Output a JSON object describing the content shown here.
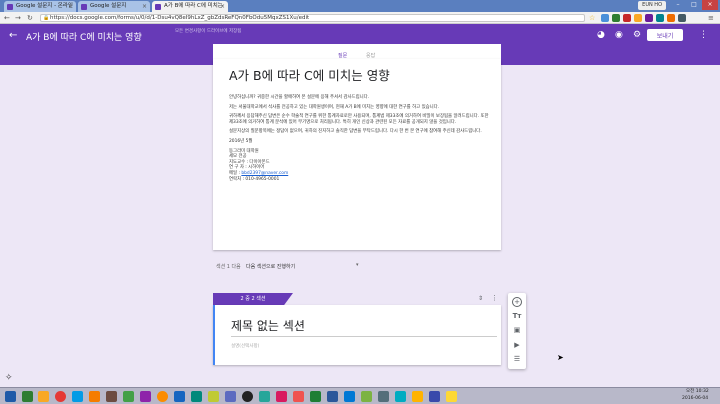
{
  "browser": {
    "tabs": [
      {
        "label": "Google 설문지 - 온라인"
      },
      {
        "label": "Google 설문지"
      },
      {
        "label": "A가 B에 따라 C에 미치는"
      }
    ],
    "user": "EUN HO",
    "url": "https://docs.google.com/forms/u/0/d/1-Dsu4vQ8eI9hLxZ_gbZdsReFQn0FbOdu5MqxZS1Xu/edit"
  },
  "header": {
    "title": "A가 B에 따라 C에 미치는 영향",
    "save_note": "모든 변경사항이 드라이브에 저장됨",
    "send_label": "보내기"
  },
  "form_tabs": {
    "questions": "질문",
    "responses": "응답"
  },
  "section1": {
    "title": "A가 B에 따라 C에 미치는 영향",
    "paragraphs": [
      "안녕하십니까? 귀중한 시간을 할애하여 본 설문에 응해 주셔서 감사드립니다.",
      "저는 서울대학교에서 석사를 전공하고 있는 대학원생이며, 현재 A가 B에 미치는 영향에 대한 연구를 하고 있습니다.",
      "귀하께서 응답해주신 답변은 순수 학술적 연구를 위한 통계자료로만 사용되며, 통계법 제33조에 의거하여 비밀이 보장됨을 알려드립니다. 또한 제33조에 의거하여 통계 분석에 있어 무기명으로 처리됩니다. 특히 개인 신상과 관련된 모든 자료를 공개되지 않을 것입니다.",
      "설문지상의 질문항목에는 정답이 없으며, 귀하의 진지하고 솔직한 답변을 부탁드립니다. 다시 한 번 본 연구에 참여해 주신데 감사드립니다."
    ],
    "date": "2016년 5월",
    "signature": [
      "동그라미 대학원",
      "세모 전공",
      "지도교수 : 다이아몬드",
      "연 구 자 : 시하이어",
      "메일 : ",
      "연락처 : 010-4965-0001"
    ],
    "email": "bbd2397@naver.com"
  },
  "after_section": {
    "label": "섹션 1 다음",
    "value": "다음 섹션으로 진행하기"
  },
  "section2": {
    "tag": "2 중 2 섹션",
    "title": "제목 없는 섹션",
    "description_placeholder": "설명(선택사항)"
  },
  "taskbar": {
    "time": "오전 10:32",
    "date": "2016-06-04"
  },
  "colors": {
    "brand": "#673ab7",
    "background": "#ede7f6",
    "accent_blue": "#4285f4"
  }
}
